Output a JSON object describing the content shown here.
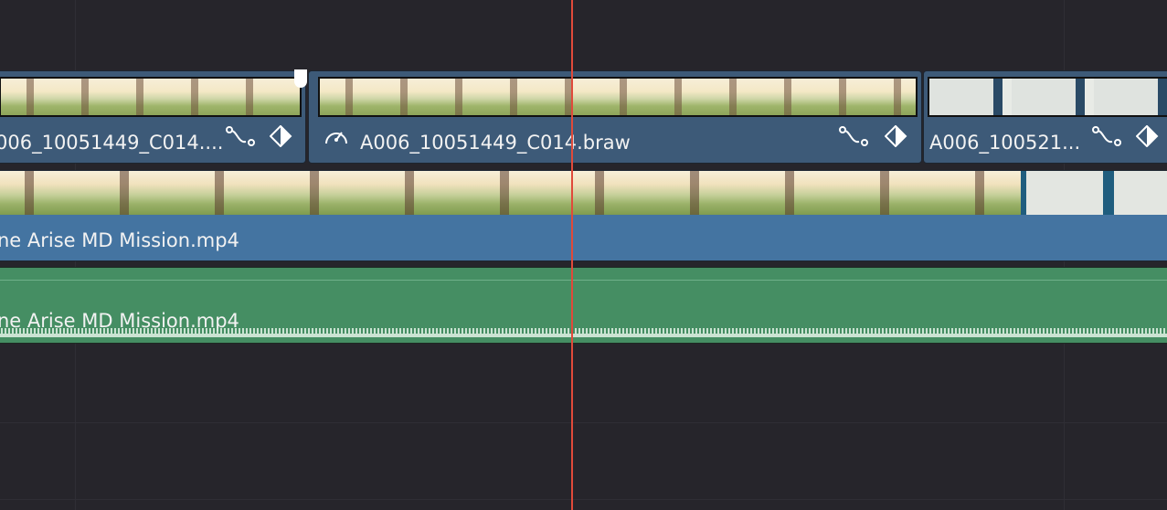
{
  "timeline": {
    "v2_clips": [
      {
        "label": "006_10051449_C014....",
        "icons": [
          "curve-icon",
          "keyframe-icon"
        ]
      },
      {
        "label": "A006_10051449_C014.braw",
        "icons": [
          "speed-icon",
          "curve-icon",
          "keyframe-icon"
        ]
      },
      {
        "label": "A006_100521...",
        "icons": [
          "curve-icon",
          "keyframe-icon"
        ]
      }
    ],
    "v1_clip": {
      "label": "ne Arise MD Mission.mp4"
    },
    "a1_clip": {
      "label": "ne Arise MD Mission.mp4"
    }
  },
  "colors": {
    "background": "#26252b",
    "video_clip": "#3d5a78",
    "video_clip_selected": "#4474a1",
    "audio_clip": "#458e63",
    "playhead": "#e04a3a"
  }
}
